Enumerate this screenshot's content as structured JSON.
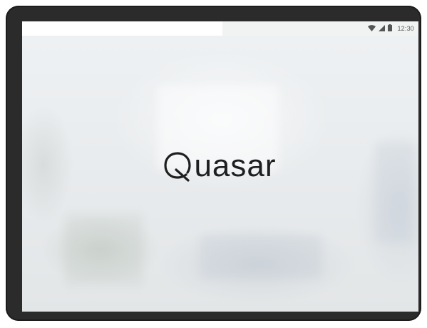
{
  "status_bar": {
    "time": "12:30",
    "icons": [
      "wifi-icon",
      "cellular-signal-icon",
      "battery-icon"
    ]
  },
  "splash": {
    "logo_letter": "Q",
    "logo_rest": "uasar"
  },
  "colors": {
    "device_frame": "#2b2b2b",
    "logo_text": "#1f1f1f",
    "status_bar_left": "#ffffff",
    "status_bar_right": "#f1f3f3"
  }
}
